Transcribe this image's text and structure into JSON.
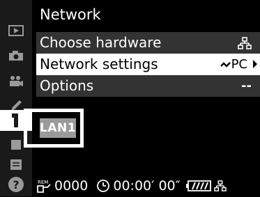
{
  "screen": {
    "title": "Network",
    "menu_items": [
      {
        "label": "Choose hardware",
        "value_icon": "wired-lan-icon",
        "value_text": ""
      },
      {
        "label": "Network settings",
        "value_icon": "wireless-pc-icon",
        "value_text": "PC"
      },
      {
        "label": "Options",
        "value_icon": "",
        "value_text": "--"
      }
    ],
    "profile_badge": "LAN1"
  },
  "sidebar": {
    "tabs": [
      "playback-icon",
      "camera-icon",
      "movie-icon",
      "pencil-icon",
      "wrench-icon",
      "retouch-icon",
      "my-menu-icon",
      "help-icon"
    ]
  },
  "status_bar": {
    "rem_label": "REM",
    "shots": "0000",
    "timer": "00:00′ 00″",
    "battery_icon": "battery-icon",
    "network_icon": "wired-lan-icon"
  },
  "colors": {
    "background": "#000000",
    "row_background": "#333333",
    "selected_row": "#ffffff",
    "badge": "#9a9a9a"
  }
}
